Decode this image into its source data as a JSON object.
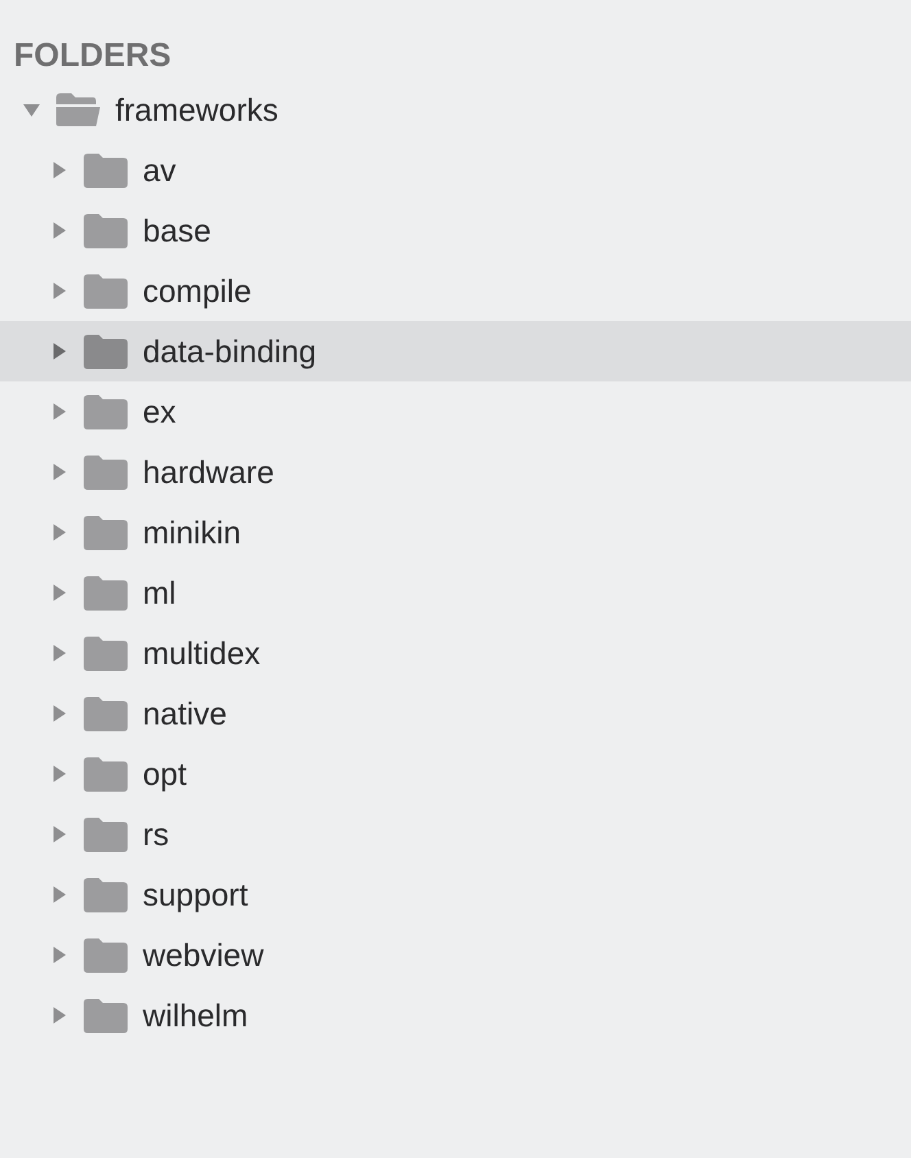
{
  "header": "FOLDERS",
  "tree": [
    {
      "label": "frameworks",
      "expanded": true,
      "selected": false,
      "children": [
        {
          "label": "av",
          "expanded": false,
          "selected": false
        },
        {
          "label": "base",
          "expanded": false,
          "selected": false
        },
        {
          "label": "compile",
          "expanded": false,
          "selected": false
        },
        {
          "label": "data-binding",
          "expanded": false,
          "selected": true
        },
        {
          "label": "ex",
          "expanded": false,
          "selected": false
        },
        {
          "label": "hardware",
          "expanded": false,
          "selected": false
        },
        {
          "label": "minikin",
          "expanded": false,
          "selected": false
        },
        {
          "label": "ml",
          "expanded": false,
          "selected": false
        },
        {
          "label": "multidex",
          "expanded": false,
          "selected": false
        },
        {
          "label": "native",
          "expanded": false,
          "selected": false
        },
        {
          "label": "opt",
          "expanded": false,
          "selected": false
        },
        {
          "label": "rs",
          "expanded": false,
          "selected": false
        },
        {
          "label": "support",
          "expanded": false,
          "selected": false
        },
        {
          "label": "webview",
          "expanded": false,
          "selected": false
        },
        {
          "label": "wilhelm",
          "expanded": false,
          "selected": false
        }
      ]
    }
  ]
}
